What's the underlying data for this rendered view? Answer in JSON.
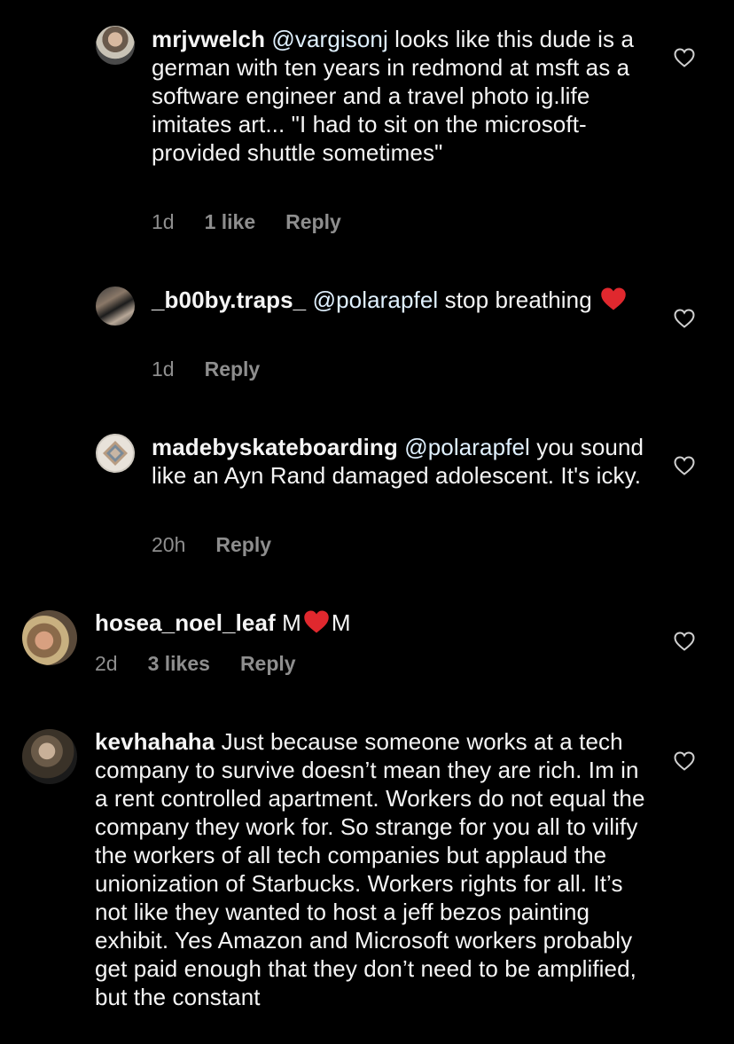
{
  "comments": [
    {
      "username": "mrjvwelch",
      "mention": "@vargisonj",
      "text": " looks like this dude is a german with ten years in redmond at msft as a software engineer and a travel photo ig.life imitates art... \"I had to sit on the microsoft-provided shuttle sometimes\"",
      "time": "1d",
      "likes": "1 like",
      "reply": "Reply"
    },
    {
      "username": "_b00by.traps_",
      "mention": "@polarapfel",
      "text": " stop breathing ",
      "time": "1d",
      "reply": "Reply"
    },
    {
      "username": "madebyskateboarding",
      "mention": "@polarapfel",
      "text": " you sound like an Ayn Rand damaged adolescent. It's icky.",
      "time": "20h",
      "reply": "Reply"
    },
    {
      "username": "hosea_noel_leaf",
      "text_before": " M",
      "text_after": "M",
      "time": "2d",
      "likes": "3 likes",
      "reply": "Reply"
    },
    {
      "username": "kevhahaha",
      "text": " Just because someone works at a tech company to survive doesn’t mean they are rich. Im in a rent controlled apartment. Workers do not equal the company they work for. So strange for you all to vilify the workers of all tech companies but applaud the unionization of Starbucks. Workers rights for all. It’s not like they wanted to host a jeff bezos painting exhibit. Yes Amazon and Microsoft workers probably get paid enough that they don’t need to be amplified, but the constant"
    }
  ],
  "colors": {
    "background": "#000000",
    "text": "#f5f5f5",
    "meta": "#8e8e8e",
    "heart_emoji": "#e0282e"
  },
  "icons": {
    "like": "heart-outline-icon",
    "emoji": "red-heart-emoji"
  }
}
